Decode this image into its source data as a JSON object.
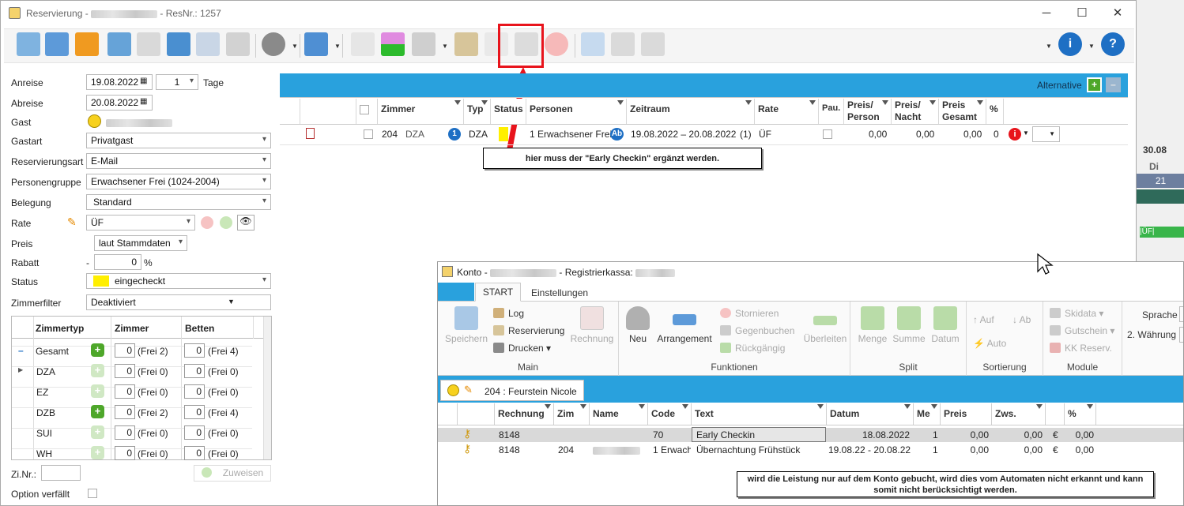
{
  "main_window": {
    "title": "Reservierung -",
    "resnr": "ResNr.: 1257"
  },
  "form": {
    "anreise_label": "Anreise",
    "anreise": "19.08.2022",
    "nights": "1",
    "tage": "Tage",
    "abreise_label": "Abreise",
    "abreise": "20.08.2022",
    "gast_label": "Gast",
    "gastart_label": "Gastart",
    "gastart": "Privatgast",
    "resart_label": "Reservierungsart",
    "resart": "E-Mail",
    "pgruppe_label": "Personengruppe",
    "pgruppe": "Erwachsener Frei (1024-2004)",
    "belegung_label": "Belegung",
    "belegung": "Standard",
    "rate_label": "Rate",
    "rate": "ÜF",
    "preis_label": "Preis",
    "preis": "laut Stammdaten",
    "rabatt_label": "Rabatt",
    "rabatt_sign": "-",
    "rabatt": "0",
    "rabatt_unit": "%",
    "status_label": "Status",
    "status": "eingecheckt",
    "zfilter_label": "Zimmerfilter",
    "zfilter": "Deaktiviert",
    "zinr_label": "Zi.Nr.:",
    "zuweisen": "Zuweisen",
    "option_label": "Option verfällt"
  },
  "room_grid": {
    "headers": [
      "Zimmertyp",
      "Zimmer",
      "Betten"
    ],
    "rows": [
      {
        "type": "Gesamt",
        "zimmer": "0",
        "zfrei": "(Frei 2)",
        "betten": "0",
        "bfrei": "(Frei 4)"
      },
      {
        "type": "DZA",
        "zimmer": "0",
        "zfrei": "(Frei 0)",
        "betten": "0",
        "bfrei": "(Frei 0)"
      },
      {
        "type": "EZ",
        "zimmer": "0",
        "zfrei": "(Frei 0)",
        "betten": "0",
        "bfrei": "(Frei 0)"
      },
      {
        "type": "DZB",
        "zimmer": "0",
        "zfrei": "(Frei 2)",
        "betten": "0",
        "bfrei": "(Frei 4)"
      },
      {
        "type": "SUI",
        "zimmer": "0",
        "zfrei": "(Frei 0)",
        "betten": "0",
        "bfrei": "(Frei 0)"
      },
      {
        "type": "WH",
        "zimmer": "0",
        "zfrei": "(Frei 0)",
        "betten": "0",
        "bfrei": "(Frei 0)"
      }
    ]
  },
  "res_table": {
    "alternative": "Alternative",
    "headers": [
      "Zimmer",
      "Typ",
      "Status",
      "Personen",
      "Zeitraum",
      "Rate",
      "Pau.",
      "Preis/ Person",
      "Preis/ Nacht",
      "Preis Gesamt",
      "%"
    ],
    "row": {
      "zimmer": "204",
      "zimmer_type": "DZA",
      "badge": "1",
      "typ": "DZA",
      "personen": "1 Erwachsener Frei",
      "ab": "Ab",
      "zeitraum": "19.08.2022 – 20.08.2022",
      "count": "(1)",
      "rate": "ÜF",
      "pp": "0,00",
      "pn": "0,00",
      "pg": "0,00",
      "pct": "0"
    }
  },
  "note_top": "hier muss der \"Early Checkin\" ergänzt werden.",
  "note_bottom": "wird die Leistung nur auf dem Konto gebucht, wird dies vom Automaten nicht erkannt und kann somit nicht berücksichtigt werden.",
  "side_calendar": {
    "date": "30.08",
    "weekday": "Di",
    "num": "21",
    "tag": "|ÜF|"
  },
  "konto": {
    "title": "Konto -",
    "kasse": "- Registrierkassa:",
    "tabs": [
      "START",
      "Einstellungen"
    ],
    "main": {
      "speichern": "Speichern",
      "log": "Log",
      "reservierung": "Reservierung",
      "drucken": "Drucken",
      "rechnung": "Rechnung",
      "label": "Main"
    },
    "funktionen": {
      "neu": "Neu",
      "arrangement": "Arrangement",
      "stornieren": "Stornieren",
      "gegenbuchen": "Gegenbuchen",
      "rueckgaengig": "Rückgängig",
      "ueberleiten": "Überleiten",
      "label": "Funktionen"
    },
    "split": {
      "menge": "Menge",
      "summe": "Summe",
      "datum": "Datum",
      "label": "Split"
    },
    "sortierung": {
      "auf": "Auf",
      "ab": "Ab",
      "auto": "Auto",
      "label": "Sortierung"
    },
    "module": {
      "skidata": "Skidata",
      "gutschein": "Gutschein",
      "kk": "KK Reserv.",
      "label": "Module"
    },
    "sprache": "Sprache",
    "waehrung": "2. Währung",
    "guest_tab": "204 :  Feurstein Nicole",
    "headers": [
      "Rechnung",
      "Zim",
      "Name",
      "Code",
      "Text",
      "Datum",
      "Me",
      "Preis",
      "Zws.",
      "",
      "%"
    ],
    "rows": [
      {
        "rechnung": "8148",
        "zim": "",
        "code": "70",
        "text": "Early Checkin",
        "datum": "18.08.2022",
        "me": "1",
        "preis": "0,00",
        "zws": "0,00",
        "cur": "€",
        "pct": "0,00"
      },
      {
        "rechnung": "8148",
        "zim": "204",
        "code": "1 Erwach",
        "text": "Übernachtung Frühstück",
        "datum": "19.08.22 - 20.08.22",
        "me": "1",
        "preis": "0,00",
        "zws": "0,00",
        "cur": "€",
        "pct": "0,00"
      }
    ]
  }
}
